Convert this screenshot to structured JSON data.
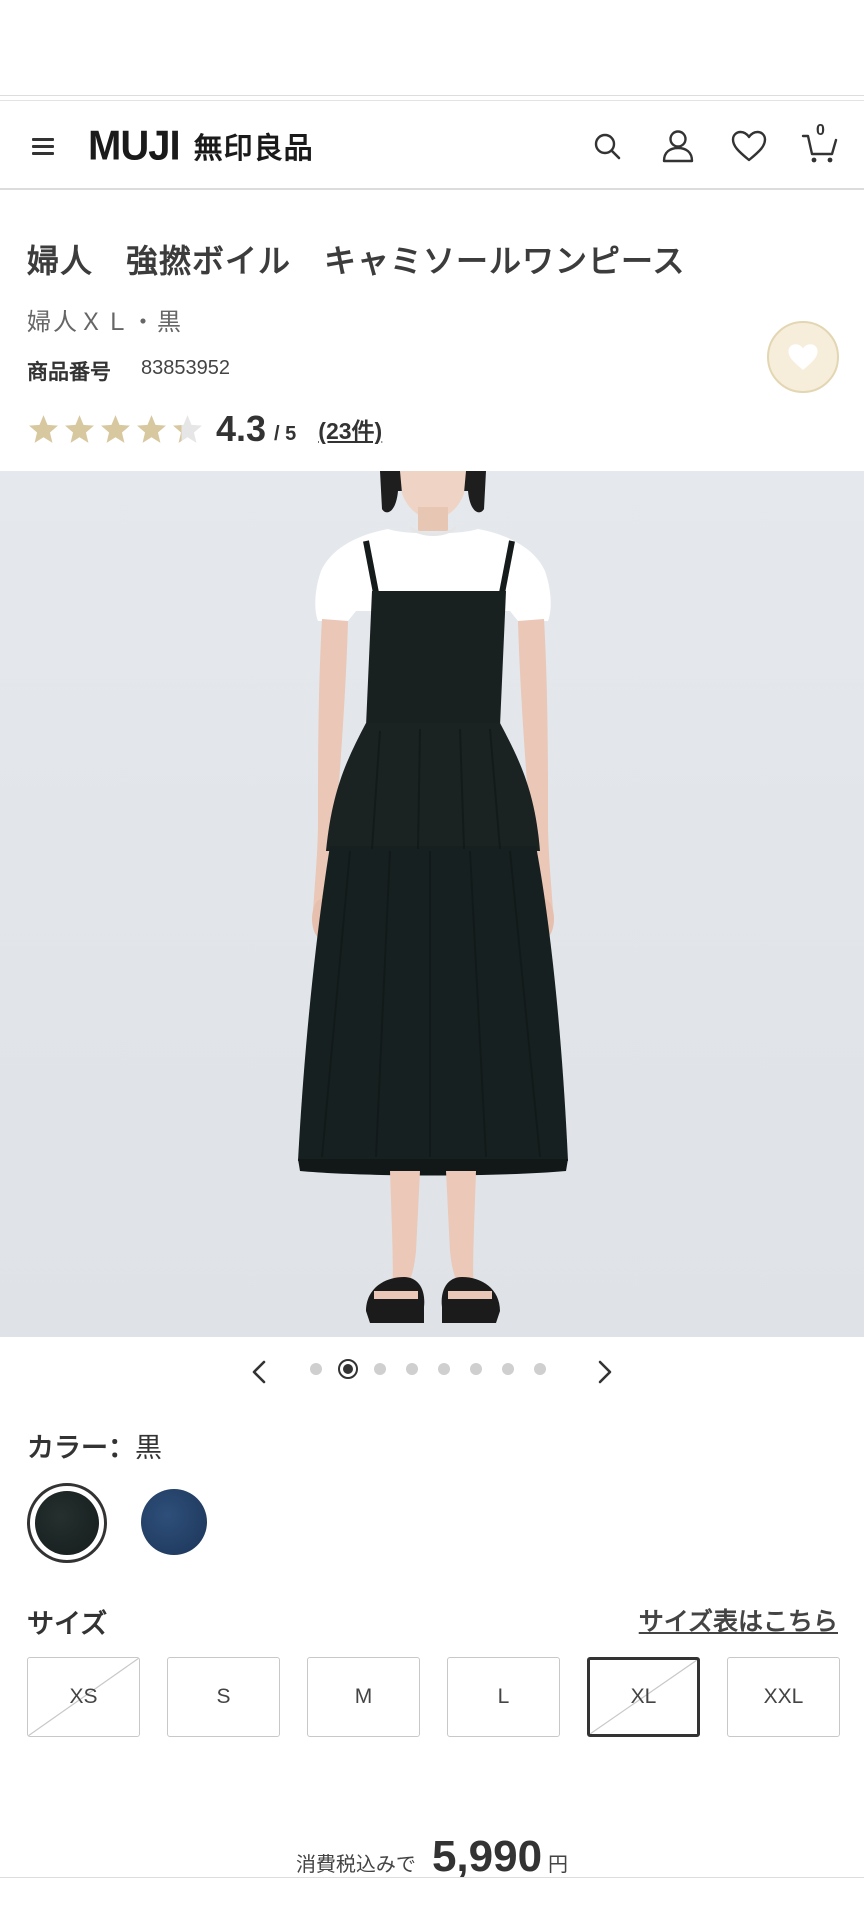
{
  "header": {
    "logo_latin": "MUJI",
    "logo_jp": "無印良品",
    "cart_count": "0",
    "icons": [
      "menu-icon",
      "search-icon",
      "account-icon",
      "heart-icon",
      "cart-icon"
    ]
  },
  "product": {
    "title": "婦人　強撚ボイル　キャミソールワンピース",
    "variant": "婦人ＸＬ・黒",
    "code_label": "商品番号",
    "code_value": "83853952",
    "rating_value": "4.3",
    "rating_max": "/ 5",
    "rating_count": "(23件)",
    "rating_stars": 4.3,
    "favorite_icon": "heart-icon"
  },
  "carousel": {
    "total": 8,
    "current": 2
  },
  "color": {
    "label": "カラー：",
    "selected": "黒",
    "options": [
      {
        "name": "black",
        "hex": "#1c2424",
        "selected": true
      },
      {
        "name": "navy",
        "hex": "#234068",
        "selected": false
      }
    ]
  },
  "size": {
    "label": "サイズ",
    "chart_link": "サイズ表はこちら",
    "options": [
      {
        "label": "XS",
        "unavailable": true,
        "selected": false
      },
      {
        "label": "S",
        "unavailable": false,
        "selected": false
      },
      {
        "label": "M",
        "unavailable": false,
        "selected": false
      },
      {
        "label": "L",
        "unavailable": false,
        "selected": false
      },
      {
        "label": "XL",
        "unavailable": true,
        "selected": true
      },
      {
        "label": "XXL",
        "unavailable": false,
        "selected": false
      }
    ]
  },
  "price": {
    "prefix": "消費税込みで",
    "value": "5,990",
    "unit": "円"
  },
  "colors": {
    "star_filled": "#d8c8a0",
    "star_empty": "#e6e6e6",
    "fav_bg": "#f6eedb"
  }
}
